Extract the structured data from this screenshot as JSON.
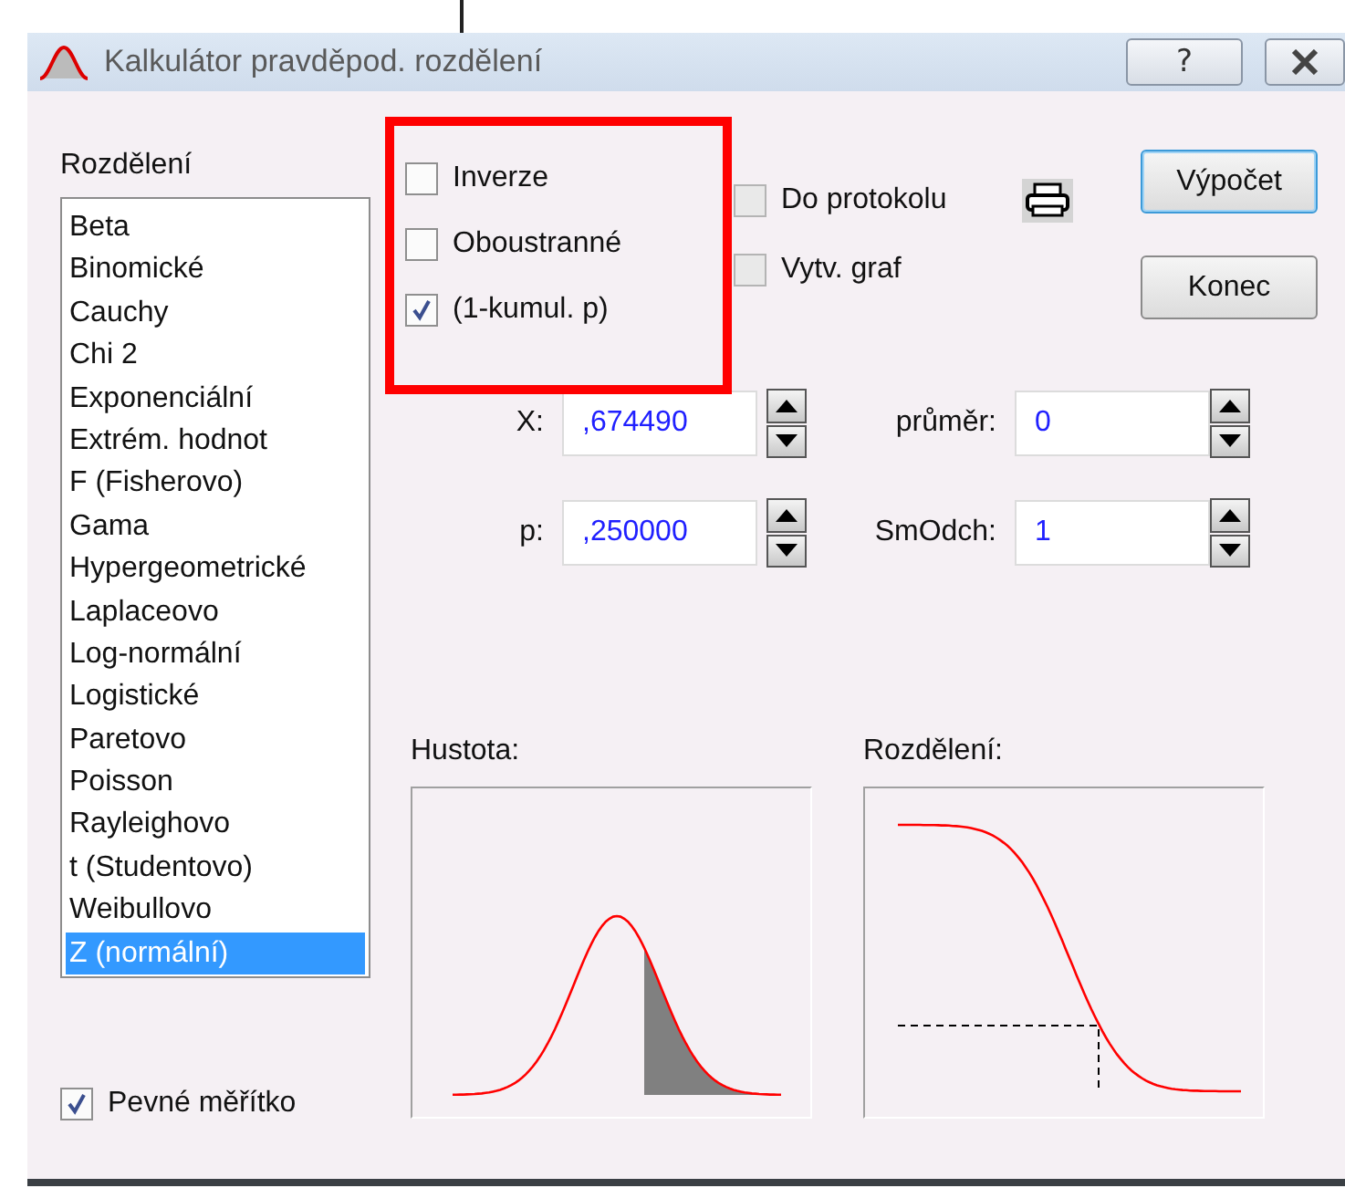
{
  "window": {
    "title": "Kalkulátor pravděpod. rozdělení",
    "help_button": "?"
  },
  "distribution_list": {
    "label": "Rozdělení",
    "items": [
      {
        "label": "Beta",
        "selected": false
      },
      {
        "label": "Binomické",
        "selected": false
      },
      {
        "label": "Cauchy",
        "selected": false
      },
      {
        "label": "Chi 2",
        "selected": false
      },
      {
        "label": "Exponenciální",
        "selected": false
      },
      {
        "label": "Extrém. hodnot",
        "selected": false
      },
      {
        "label": "F (Fisherovo)",
        "selected": false
      },
      {
        "label": "Gama",
        "selected": false
      },
      {
        "label": "Hypergeometrické",
        "selected": false
      },
      {
        "label": "Laplaceovo",
        "selected": false
      },
      {
        "label": "Log-normální",
        "selected": false
      },
      {
        "label": "Logistické",
        "selected": false
      },
      {
        "label": "Paretovo",
        "selected": false
      },
      {
        "label": "Poisson",
        "selected": false
      },
      {
        "label": "Rayleighovo",
        "selected": false
      },
      {
        "label": "t (Studentovo)",
        "selected": false
      },
      {
        "label": "Weibullovo",
        "selected": false
      },
      {
        "label": "Z (normální)",
        "selected": true
      }
    ]
  },
  "options": [
    {
      "label": "Inverze",
      "checked": false,
      "disabled": false
    },
    {
      "label": "Oboustranné",
      "checked": false,
      "disabled": false
    },
    {
      "label": "(1-kumul. p)",
      "checked": true,
      "disabled": false
    }
  ],
  "output_options": [
    {
      "label": "Do protokolu",
      "checked": false,
      "disabled": true
    },
    {
      "label": "Vytv. graf",
      "checked": false,
      "disabled": true
    }
  ],
  "buttons": [
    {
      "label": "Výpočet",
      "default": true
    },
    {
      "label": "Konec",
      "default": false
    }
  ],
  "fields": [
    {
      "label": "X:",
      "value": ",674490"
    },
    {
      "label": "průměr:",
      "value": "0"
    },
    {
      "label": "p:",
      "value": ",250000"
    },
    {
      "label": "SmOdch:",
      "value": "1"
    }
  ],
  "charts": [
    {
      "label": "Hustota:",
      "kind": "density"
    },
    {
      "label": "Rozdělení:",
      "kind": "distribution"
    }
  ],
  "fixed_scale": {
    "label": "Pevné měřítko",
    "checked": true
  }
}
